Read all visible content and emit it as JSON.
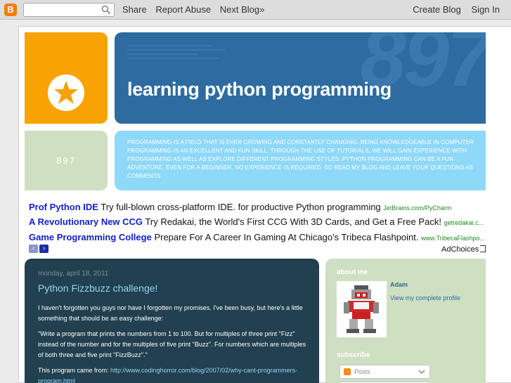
{
  "navbar": {
    "logo": "B",
    "search_placeholder": "",
    "share": "Share",
    "report_abuse": "Report Abuse",
    "next_blog": "Next Blog»",
    "create_blog": "Create Blog",
    "sign_in": "Sign In"
  },
  "header": {
    "title": "learning python programming",
    "bg_number": "897",
    "side_number": "897",
    "description": "Programming is a field that is ever growing and constantly changing. Being knowledgeable in computer programming is an excellent and fun skill. Through the use of tutorials, we will gain experience with programming as well as explore different programming styles. Python programming can be a fun adventure, even for a beginner. No experience is required, so read my blog and leave your questions as comments."
  },
  "ads": [
    {
      "title": "Prof Python IDE",
      "text": "Try full-blown cross-platform IDE. for productive Python programming",
      "url": "JetBrains.com/PyCharm"
    },
    {
      "title": "A Revolutionary New CCG",
      "text": "Try Redakai, the World's First CCG With 3D Cards, and Get a Free Pack!",
      "url": "getredakai.c..."
    },
    {
      "title": "Game Programming College",
      "text": "Prepare For A Career In Gaming At Chicago's Tribeca Flashpoint.",
      "url": "www.TribecaFlashpo..."
    }
  ],
  "ad_nav": {
    "prev": "‹",
    "next": "›"
  },
  "adchoices": "AdChoices",
  "post": {
    "date": "monday, april 18, 2011",
    "title": "Python Fizzbuzz challenge!",
    "p1": "I haven't forgotten you guys nor have I forgotten my promises.  I've been busy, but here's a little something that should be an easy challenge:",
    "p2": "\"Write a program that prints the numbers from 1 to 100. But for multiples of three print \"Fizz\" instead of the number and for the multiples of five print \"Buzz\". For numbers which are multiples of both three and five print \"FizzBuzz\".\"",
    "p3_prefix": "This program came from: ",
    "p3_link": "http://www.codinghorror.com/blog/2007/02/why-cant-programmers-program.html"
  },
  "sidebar": {
    "about_heading": "about me",
    "profile_name": "Adam",
    "profile_link": "View my complete profile",
    "subscribe_heading": "subscribe",
    "subscribe_option": "Posts"
  },
  "colors": {
    "orange": "#f8a204",
    "title_blue": "#2d6ba0",
    "light_blue": "#8ed8f8",
    "sage": "#cfdfc2",
    "post_bg": "#22404f"
  }
}
